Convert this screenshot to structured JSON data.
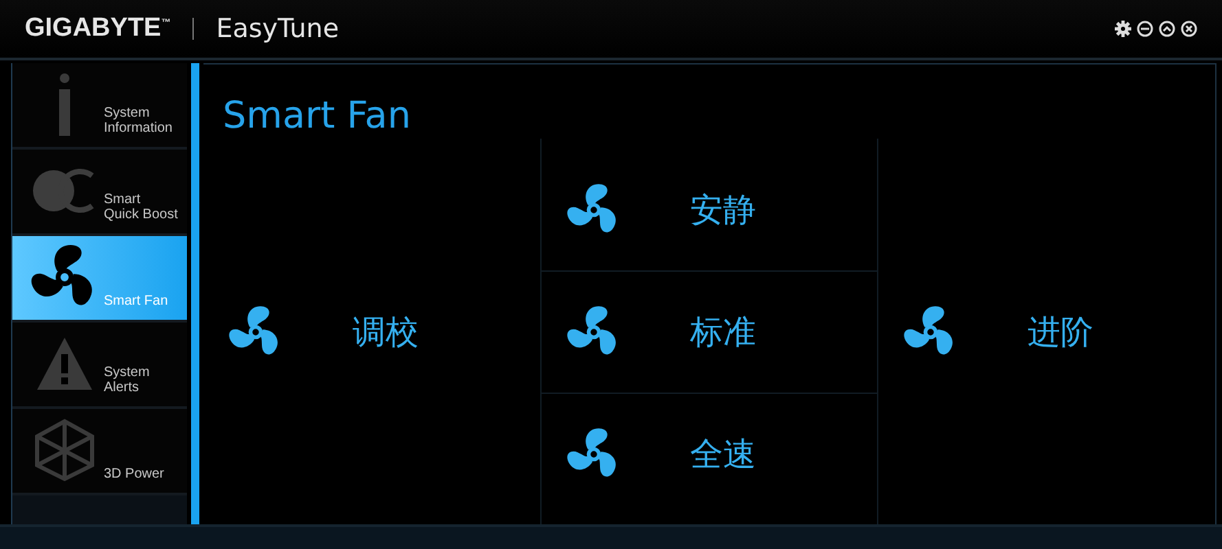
{
  "window": {
    "brand": "GIGABYTE$^{™}$",
    "app": "EasyTune"
  },
  "sidebar": {
    "items": [
      {
        "kind": "info",
        "label": "System Information",
        "selected": false
      },
      {
        "kind": "oc",
        "label": "Smart Quick Boost",
        "selected": false
      },
      {
        "kind": "fan",
        "label": "Smart Fan",
        "selected": true
      },
      {
        "kind": "alert",
        "label": "System Alerts",
        "selected": false
      },
      {
        "kind": "cube",
        "label": "3D Power",
        "selected": false
      }
    ]
  },
  "content": {
    "title": "Smart Fan",
    "columns": [
      {
        "modes": [
          {
            "label": "调校"
          }
        ]
      },
      {
        "modes": [
          {
            "label": "安静"
          },
          {
            "label": "标准"
          },
          {
            "label": "全速"
          }
        ]
      },
      {
        "modes": [
          {
            "label": "进阶"
          }
        ]
      }
    ]
  }
}
